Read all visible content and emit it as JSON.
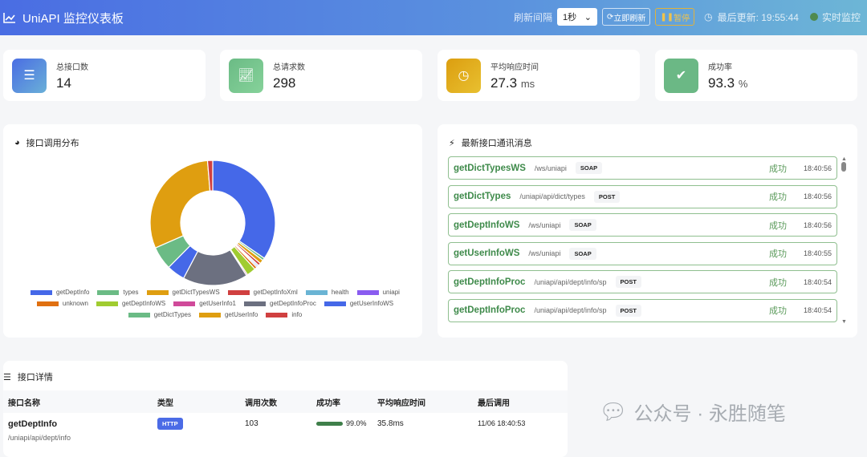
{
  "header": {
    "title": "UniAPI 监控仪表板",
    "refresh_label": "刷新间隔",
    "interval": "1秒",
    "refresh_now": "立即刷新",
    "pause": "暂停",
    "last_update": "最后更新: 19:55:44",
    "live": "实时监控"
  },
  "stats": [
    {
      "label": "总接口数",
      "value": "14",
      "unit": ""
    },
    {
      "label": "总请求数",
      "value": "298",
      "unit": ""
    },
    {
      "label": "平均响应时间",
      "value": "27.3",
      "unit": "ms"
    },
    {
      "label": "成功率",
      "value": "93.3",
      "unit": "%"
    }
  ],
  "chart_title": "接口调用分布",
  "chart_data": {
    "type": "pie",
    "donut": true,
    "title": "接口调用分布",
    "legend": "bottom",
    "categories": [
      "getDeptInfo",
      "types",
      "getDictTypesWS",
      "getDeptInfoXml",
      "health",
      "uniapi",
      "unknown",
      "getDeptInfoWS",
      "getUserInfo1",
      "getDeptInfoProc",
      "getUserInfoWS",
      "getDictTypes",
      "getUserInfo",
      "info"
    ],
    "values": [
      103,
      2,
      3,
      2,
      1,
      1,
      2,
      7,
      1,
      50,
      14,
      18,
      90,
      4
    ],
    "colors": [
      "#4568e8",
      "#6bbb85",
      "#df9e10",
      "#d04040",
      "#6ab4d4",
      "#8a5cf0",
      "#e07010",
      "#a0cc30",
      "#d04a9a",
      "#6c7080",
      "#4568e8",
      "#6bbb85",
      "#df9e10",
      "#d04040"
    ]
  },
  "messages_title": "最新接口通讯消息",
  "messages": [
    {
      "name": "getDictTypesWS",
      "path": "/ws/uniapi",
      "method": "SOAP",
      "status": "成功",
      "time": "18:40:56"
    },
    {
      "name": "getDictTypes",
      "path": "/uniapi/api/dict/types",
      "method": "POST",
      "status": "成功",
      "time": "18:40:56"
    },
    {
      "name": "getDeptInfoWS",
      "path": "/ws/uniapi",
      "method": "SOAP",
      "status": "成功",
      "time": "18:40:56"
    },
    {
      "name": "getUserInfoWS",
      "path": "/ws/uniapi",
      "method": "SOAP",
      "status": "成功",
      "time": "18:40:55"
    },
    {
      "name": "getDeptInfoProc",
      "path": "/uniapi/api/dept/info/sp",
      "method": "POST",
      "status": "成功",
      "time": "18:40:54"
    },
    {
      "name": "getDeptInfoProc",
      "path": "/uniapi/api/dept/info/sp",
      "method": "POST",
      "status": "成功",
      "time": "18:40:54"
    }
  ],
  "details": {
    "title": "接口详情",
    "columns": [
      "接口名称",
      "类型",
      "调用次数",
      "成功率",
      "平均响应时间",
      "最后调用"
    ],
    "rows": [
      {
        "name": "getDeptInfo",
        "path": "/uniapi/api/dept/info",
        "type": "HTTP",
        "count": "103",
        "rate": "99.0%",
        "rate_value": 99.0,
        "avg": "35.8ms",
        "last": "11/06 18:40:53"
      }
    ]
  },
  "watermark": "公众号 · 永胜随笔"
}
